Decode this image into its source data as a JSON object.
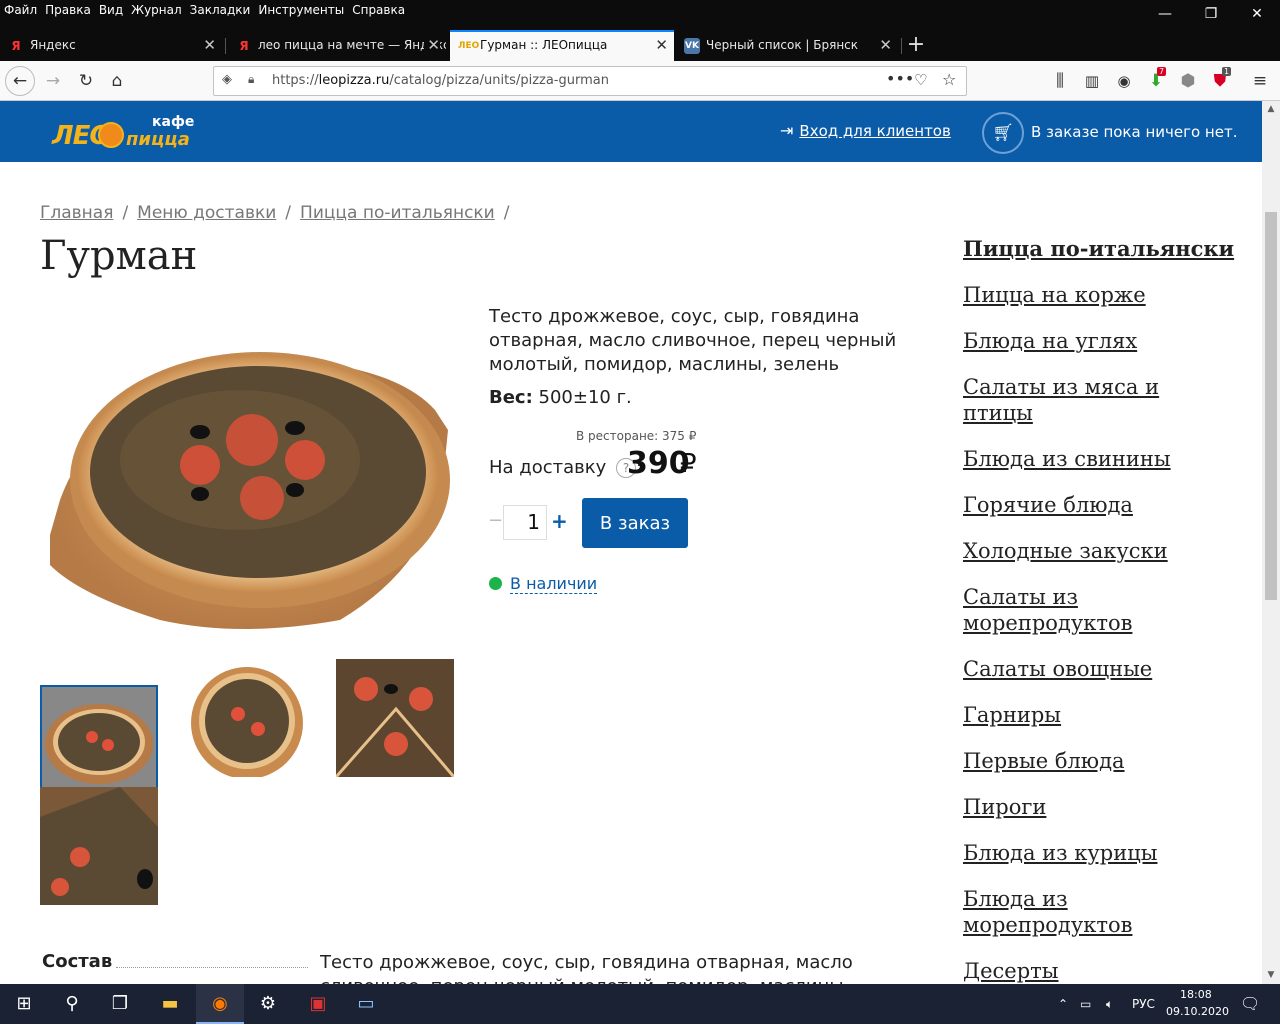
{
  "browser": {
    "menu": [
      "Файл",
      "Правка",
      "Вид",
      "Журнал",
      "Закладки",
      "Инструменты",
      "Справка"
    ],
    "tabs": [
      {
        "title": "Яндекс",
        "favicon": "yandex-icon",
        "active": false
      },
      {
        "title": "лео пицца на мечте — Яндекс",
        "favicon": "yandex-icon",
        "active": false
      },
      {
        "title": "Гурман :: ЛЕОпицца",
        "favicon": "leopizza-icon",
        "active": true
      },
      {
        "title": "Черный список | Брянск",
        "favicon": "vk-icon",
        "active": false
      }
    ],
    "url_prefix": "https://",
    "url_domain": "leopizza.ru",
    "url_path": "/catalog/pizza/units/pizza-gurman",
    "notifications": {
      "downloads_badge": "7",
      "extension_badge": "1"
    }
  },
  "site": {
    "logo_top": "кафе",
    "logo_brand": "ЛЕО",
    "logo_bottom": "пицца",
    "login_label": "Вход для клиентов",
    "cart_status": "В заказе пока ничего нет.",
    "accent_color": "#0a5ba8"
  },
  "breadcrumb": [
    "Главная",
    "Меню доставки",
    "Пицца по-итальянски"
  ],
  "product": {
    "title": "Гурман",
    "description": "Тесто дрожжевое, соус, сыр, говядина отварная, масло сливочное, перец черный молотый, помидор, маслины, зелень",
    "weight_label": "Вес:",
    "weight_value": "500±10 г.",
    "restaurant_price": "В ресторане: 375 ₽",
    "delivery_label": "На доставку",
    "delivery_price": "390",
    "currency": "₽",
    "help_glyph": "?",
    "quantity": "1",
    "minus": "−",
    "plus": "+",
    "order_button": "В заказ",
    "stock_status": "В наличии",
    "composition_label": "Состав",
    "composition_value": "Тесто дрожжевое, соус, сыр, говядина отварная, масло сливочное, перец черный молотый, помидор, маслины, зелень"
  },
  "sidebar": [
    {
      "label": "Пицца по-итальянски",
      "current": true
    },
    {
      "label": "Пицца на корже"
    },
    {
      "label": "Блюда на углях"
    },
    {
      "label": "Салаты из мяса и птицы"
    },
    {
      "label": "Блюда из свинины"
    },
    {
      "label": "Горячие блюда"
    },
    {
      "label": "Холодные закуски"
    },
    {
      "label": "Салаты из морепродуктов"
    },
    {
      "label": "Салаты овощные"
    },
    {
      "label": "Гарниры"
    },
    {
      "label": "Первые блюда"
    },
    {
      "label": "Пироги"
    },
    {
      "label": "Блюда из курицы"
    },
    {
      "label": "Блюда из морепродуктов"
    },
    {
      "label": "Десерты"
    }
  ],
  "taskbar": {
    "language": "РУС",
    "time": "18:08",
    "date": "09.10.2020"
  }
}
